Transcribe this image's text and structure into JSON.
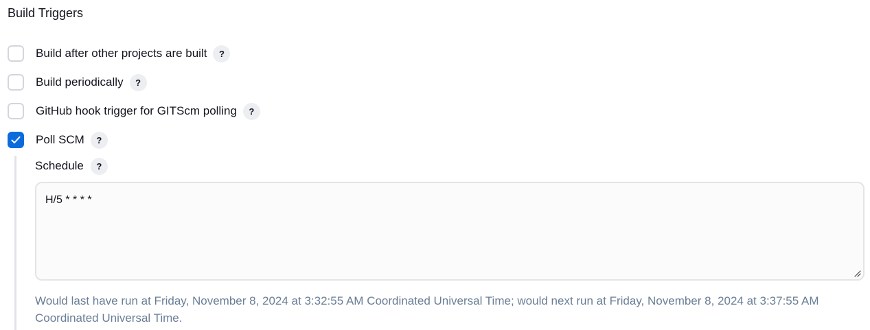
{
  "section": {
    "title": "Build Triggers"
  },
  "triggers": [
    {
      "label": "Build after other projects are built",
      "checked": false,
      "help": "?"
    },
    {
      "label": "Build periodically",
      "checked": false,
      "help": "?"
    },
    {
      "label": "GitHub hook trigger for GITScm polling",
      "checked": false,
      "help": "?"
    },
    {
      "label": "Poll SCM",
      "checked": true,
      "help": "?"
    }
  ],
  "schedule": {
    "label": "Schedule",
    "help": "?",
    "value": "H/5 * * * *",
    "info": "Would last have run at Friday, November 8, 2024 at 3:32:55 AM Coordinated Universal Time; would next run at Friday, November 8, 2024 at 3:37:55 AM Coordinated Universal Time."
  },
  "colors": {
    "checkbox_checked": "#0b6bdc",
    "checkbox_border": "#d4d6dd",
    "help_bg": "#eceef2",
    "info_text": "#6a7e96"
  }
}
